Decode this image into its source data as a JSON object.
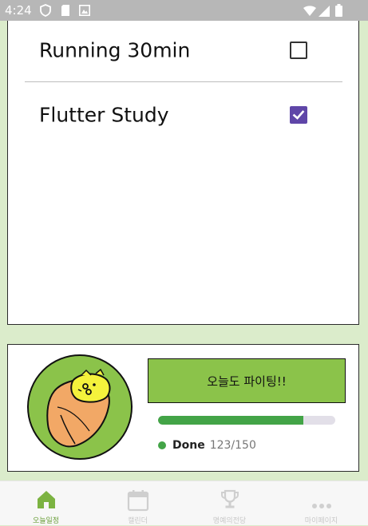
{
  "status_bar": {
    "time": "4:24"
  },
  "todos": [
    {
      "label": "Running 30min",
      "checked": false
    },
    {
      "label": "Flutter Study",
      "checked": true
    }
  ],
  "profile": {
    "cheer_button": "오늘도 파이팅!!",
    "progress": 0.82,
    "done_label": "Done",
    "done_count": "123/150"
  },
  "nav": {
    "items": [
      {
        "label": "오늘일정",
        "icon": "home-icon",
        "active": true
      },
      {
        "label": "캘린더",
        "icon": "calendar-icon",
        "active": false
      },
      {
        "label": "명예의전당",
        "icon": "trophy-icon",
        "active": false
      },
      {
        "label": "마이페이지",
        "icon": "more-icon",
        "active": false
      }
    ]
  },
  "colors": {
    "accent_green": "#8bc34a",
    "progress_green": "#43a447",
    "checkbox_purple": "#5f46a8",
    "page_bg": "#dbeccb"
  }
}
